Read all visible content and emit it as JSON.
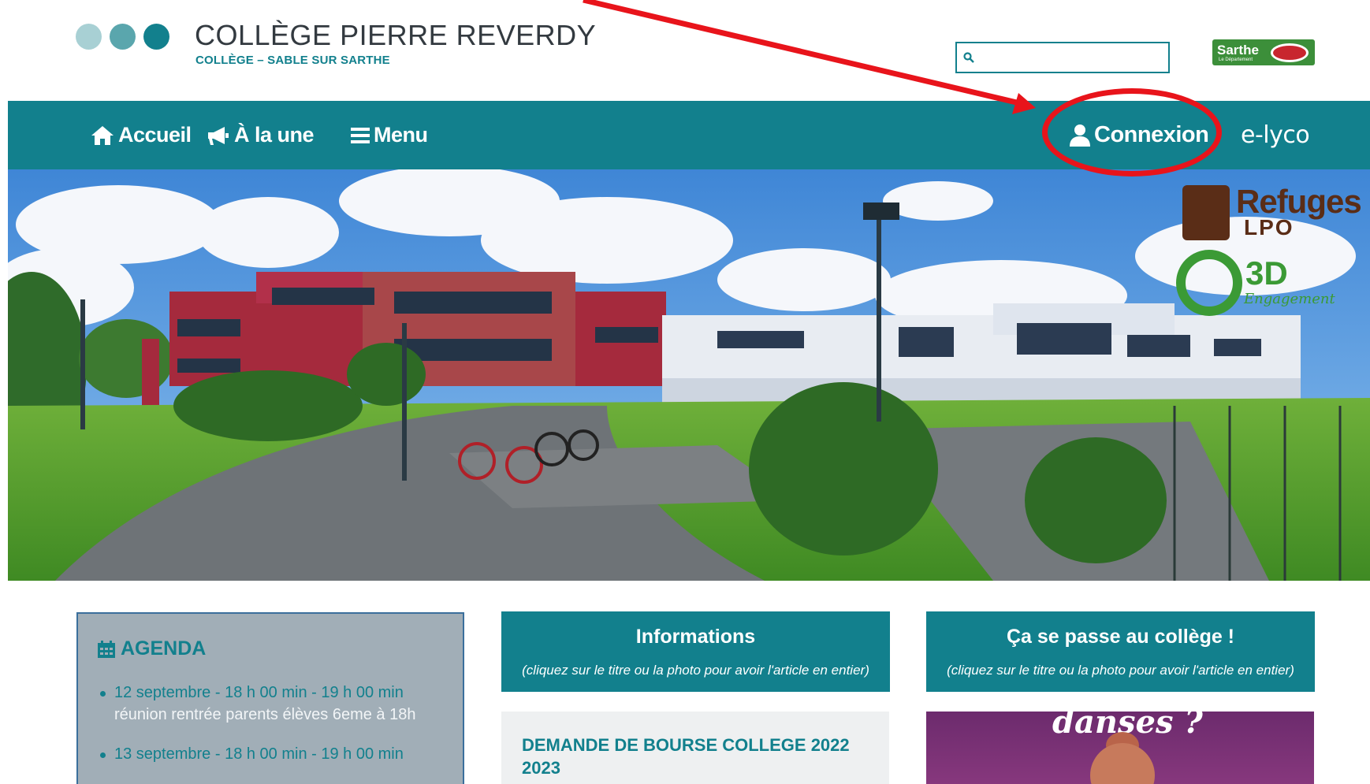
{
  "header": {
    "title": "COLLÈGE PIERRE REVERDY",
    "subtitle": "COLLÈGE – SABLE SUR SARTHE",
    "dots": [
      "#a8d0d4",
      "#5aa6ad",
      "#12808d"
    ],
    "search": {
      "value": "",
      "placeholder": ""
    },
    "partner_logo": {
      "name": "Sarthe",
      "sub": "Le Département"
    }
  },
  "nav": {
    "items": [
      {
        "label": "Accueil",
        "icon": "home-icon"
      },
      {
        "label": "À la une",
        "icon": "megaphone-icon"
      },
      {
        "label": "Menu",
        "icon": "hamburger-icon"
      }
    ],
    "connexion": {
      "label": "Connexion",
      "icon": "user-icon"
    },
    "elyco": "e-lyco"
  },
  "hero": {
    "logos": {
      "refuges": {
        "line1": "Refuges",
        "line2": "LPO"
      },
      "e3d": {
        "mark": "3D",
        "sub": "Engagement"
      }
    }
  },
  "agenda": {
    "title": "AGENDA",
    "icon": "calendar-icon",
    "items": [
      {
        "date": "12 septembre - 18 h 00 min - 19 h 00 min",
        "desc": "réunion rentrée parents élèves 6eme à 18h"
      },
      {
        "date": "13 septembre - 18 h 00 min - 19 h 00 min",
        "desc": ""
      }
    ]
  },
  "informations": {
    "title": "Informations",
    "subtitle": "(cliquez sur le titre ou la photo pour avoir l'article en entier)",
    "article_title": "DEMANDE DE BOURSE COLLEGE 2022 2023"
  },
  "college": {
    "title": "Ça se passe au collège !",
    "subtitle": "(cliquez sur le titre ou la photo pour avoir l'article en entier)",
    "photo_text": "danses ?"
  },
  "colors": {
    "primary": "#12808d",
    "annotation": "#e8141b",
    "agenda_bg": "#a1aeb7"
  }
}
